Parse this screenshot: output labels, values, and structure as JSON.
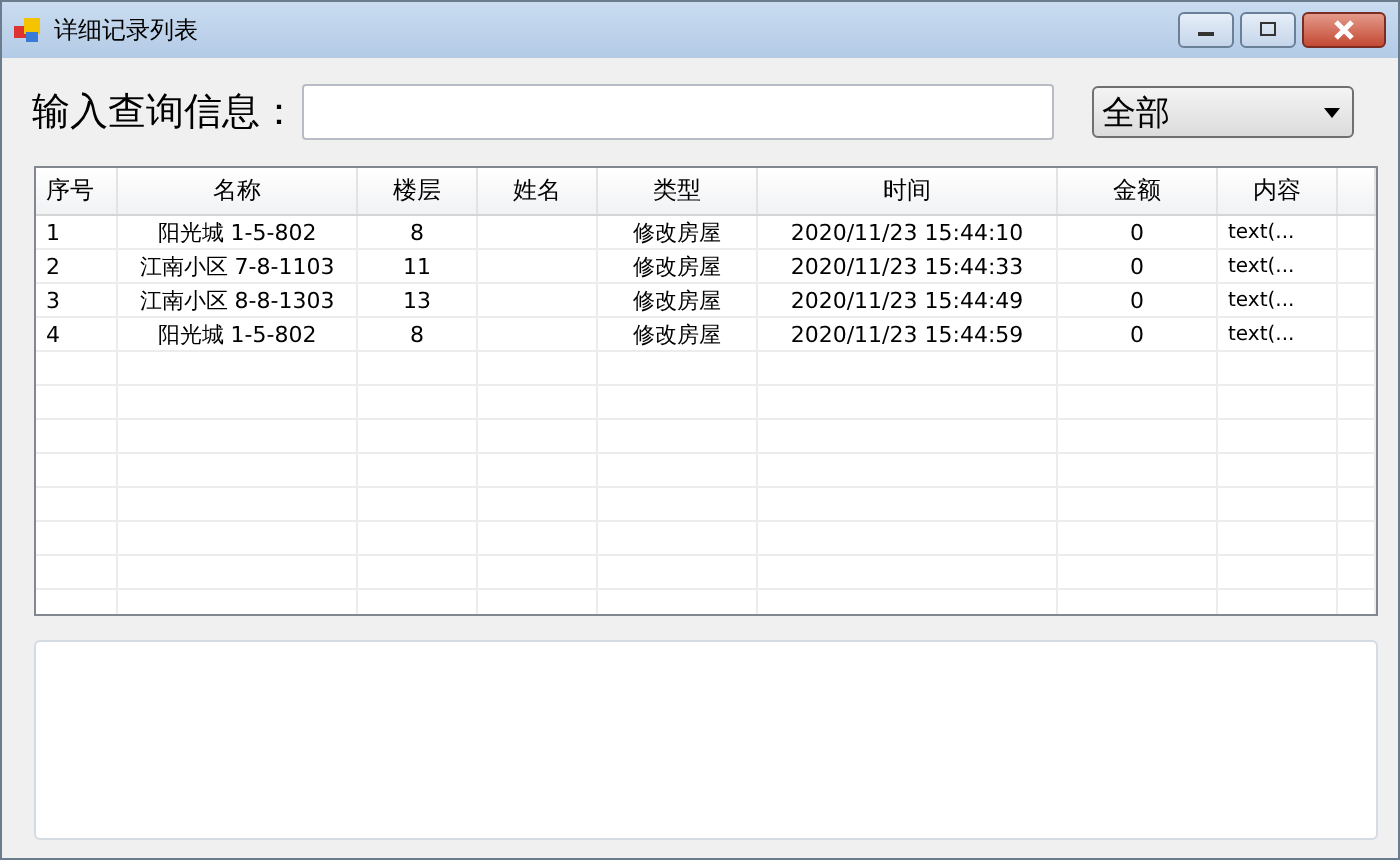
{
  "window": {
    "title": "详细记录列表"
  },
  "search": {
    "label": "输入查询信息："
  },
  "filter": {
    "value": "全部"
  },
  "table": {
    "columns": [
      "序号",
      "名称",
      "楼层",
      "姓名",
      "类型",
      "时间",
      "金额",
      "内容"
    ],
    "rows": [
      [
        "1",
        "阳光城 1-5-802",
        "8",
        "",
        "修改房屋",
        "2020/11/23 15:44:10",
        "0",
        "text(..."
      ],
      [
        "2",
        "江南小区 7-8-1103",
        "11",
        "",
        "修改房屋",
        "2020/11/23 15:44:33",
        "0",
        "text(..."
      ],
      [
        "3",
        "江南小区 8-8-1303",
        "13",
        "",
        "修改房屋",
        "2020/11/23 15:44:49",
        "0",
        "text(..."
      ],
      [
        "4",
        "阳光城 1-5-802",
        "8",
        "",
        "修改房屋",
        "2020/11/23 15:44:59",
        "0",
        "text(..."
      ]
    ]
  }
}
